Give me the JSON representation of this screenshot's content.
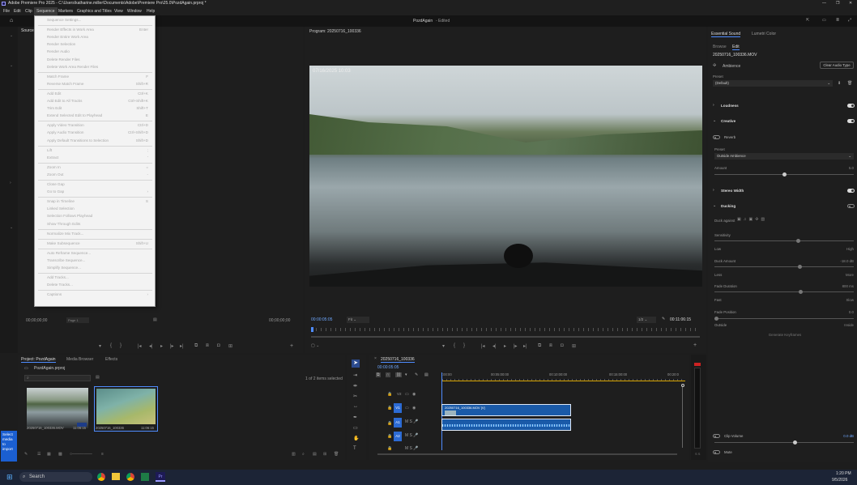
{
  "window": {
    "title": "Adobe Premiere Pro 2025 - C:\\Users\\katharine.miller\\Documents\\Adobe\\Premiere Pro\\25.0\\PozdAgain.prproj *"
  },
  "menu": [
    "File",
    "Edit",
    "Clip",
    "Sequence",
    "Markers",
    "Graphics and Titles",
    "View",
    "Window",
    "Help"
  ],
  "header": {
    "project_title": "PozdAgain",
    "edited": "- Edited",
    "source_tab": "Source"
  },
  "sequence_menu": [
    {
      "label": "Sequence Settings...",
      "shortcut": ""
    },
    {
      "sep": true
    },
    {
      "label": "Render Effects in Work Area",
      "shortcut": "Enter"
    },
    {
      "label": "Render Entire Work Area",
      "shortcut": ""
    },
    {
      "label": "Render Selection",
      "shortcut": ""
    },
    {
      "label": "Render Audio",
      "shortcut": ""
    },
    {
      "label": "Delete Render Files",
      "shortcut": ""
    },
    {
      "label": "Delete Work Area Render Files",
      "shortcut": ""
    },
    {
      "sep": true
    },
    {
      "label": "Match Frame",
      "shortcut": "F"
    },
    {
      "label": "Reverse Match Frame",
      "shortcut": "Shift+R"
    },
    {
      "sep": true
    },
    {
      "label": "Add Edit",
      "shortcut": "Ctrl+K"
    },
    {
      "label": "Add Edit to All Tracks",
      "shortcut": "Ctrl+Shift+K"
    },
    {
      "label": "Trim Edit",
      "shortcut": "Shift+T"
    },
    {
      "label": "Extend Selected Edit to Playhead",
      "shortcut": "E"
    },
    {
      "sep": true
    },
    {
      "label": "Apply Video Transition",
      "shortcut": "Ctrl+D"
    },
    {
      "label": "Apply Audio Transition",
      "shortcut": "Ctrl+Shift+D"
    },
    {
      "label": "Apply Default Transitions to Selection",
      "shortcut": "Shift+D"
    },
    {
      "sep": true
    },
    {
      "label": "Lift",
      "shortcut": ";"
    },
    {
      "label": "Extract",
      "shortcut": "'"
    },
    {
      "sep": true
    },
    {
      "label": "Zoom In",
      "shortcut": "="
    },
    {
      "label": "Zoom Out",
      "shortcut": "-"
    },
    {
      "sep": true
    },
    {
      "label": "Close Gap",
      "shortcut": ""
    },
    {
      "label": "Go to Gap",
      "shortcut": "›"
    },
    {
      "sep": true
    },
    {
      "label": "Snap in Timeline",
      "shortcut": "S"
    },
    {
      "label": "Linked Selection",
      "shortcut": ""
    },
    {
      "label": "Selection Follows Playhead",
      "shortcut": ""
    },
    {
      "label": "Show Through Edits",
      "shortcut": ""
    },
    {
      "sep": true
    },
    {
      "label": "Normalize Mix Track...",
      "shortcut": ""
    },
    {
      "sep": true
    },
    {
      "label": "Make Subsequence",
      "shortcut": "Shift+U"
    },
    {
      "sep": true
    },
    {
      "label": "Auto Reframe Sequence...",
      "shortcut": ""
    },
    {
      "label": "Transcribe Sequence...",
      "shortcut": ""
    },
    {
      "label": "Simplify Sequence...",
      "shortcut": ""
    },
    {
      "sep": true
    },
    {
      "label": "Add Tracks...",
      "shortcut": ""
    },
    {
      "label": "Delete Tracks...",
      "shortcut": ""
    },
    {
      "sep": true
    },
    {
      "label": "Captions",
      "shortcut": "›"
    }
  ],
  "source_monitor": {
    "timecode_left": "00;00;00;00",
    "page": "Page 1",
    "timecode_right": "00;00;00;00"
  },
  "program_monitor": {
    "tab": "Program: 20250716_100336",
    "overlay_date": "07/16/2025 10:03",
    "timecode": "00:00:05:05",
    "fit": "Fit",
    "quality": "1/2",
    "duration": "00:11:06:15"
  },
  "project_panel": {
    "tabs": [
      "Project: PozdAgain",
      "Media Browser",
      "Effects"
    ],
    "file": "PozdAgain.prproj",
    "selection": "1 of 2 items selected",
    "items": [
      {
        "name": "20250716_100336.MOV",
        "duration": "11:06:15"
      },
      {
        "name": "20250716_100336",
        "duration": "11:06:15"
      }
    ]
  },
  "timeline": {
    "tab": "20250716_100336",
    "timecode": "00:00:05:05",
    "ruler": [
      ":00:00",
      "00:05:00:00",
      "00:10:00:00",
      "00:15:00:00",
      "00:20:0"
    ],
    "tracks": [
      "V2",
      "V1",
      "A1",
      "A2",
      "A3"
    ],
    "clip_label": "20250716_100336.MOV [V]"
  },
  "essential_sound": {
    "tabs": [
      "Essential Sound",
      "Lumetri Color"
    ],
    "subtabs": [
      "Browse",
      "Edit"
    ],
    "clip": "20250716_100336.MOV",
    "type": "Ambience",
    "clear_btn": "Clear Audio Type",
    "preset_label": "Preset",
    "preset_value": "(Default)",
    "loudness": "Loudness",
    "creative": "Creative",
    "reverb": "Reverb",
    "preset2": "Preset",
    "preset2_value": "Outside Ambience",
    "amount": "Amount",
    "amount_val": "5.0",
    "stereo": "Stereo Width",
    "ducking": "Ducking",
    "duck_against": "Duck against",
    "sensitivity": "Sensitivity",
    "low": "Low",
    "high": "High",
    "duck_amount": "Duck Amount",
    "duck_val": "-18.0 dB",
    "less": "Less",
    "more": "More",
    "fade_duration": "Fade Duration",
    "fade_val": "800 ms",
    "fast": "Fast",
    "slow": "Slow",
    "fade_position": "Fade Position",
    "pos_val": "0.0",
    "outside": "Outside",
    "inside": "Inside",
    "generate": "Generate Keyframes",
    "clip_volume": "Clip Volume",
    "cv_val": "0.0 dB",
    "mute": "Mute"
  },
  "tooltip": "Select media to import",
  "taskbar": {
    "search": "Search",
    "time": "1:20 PM",
    "date": "9/5/2026"
  }
}
